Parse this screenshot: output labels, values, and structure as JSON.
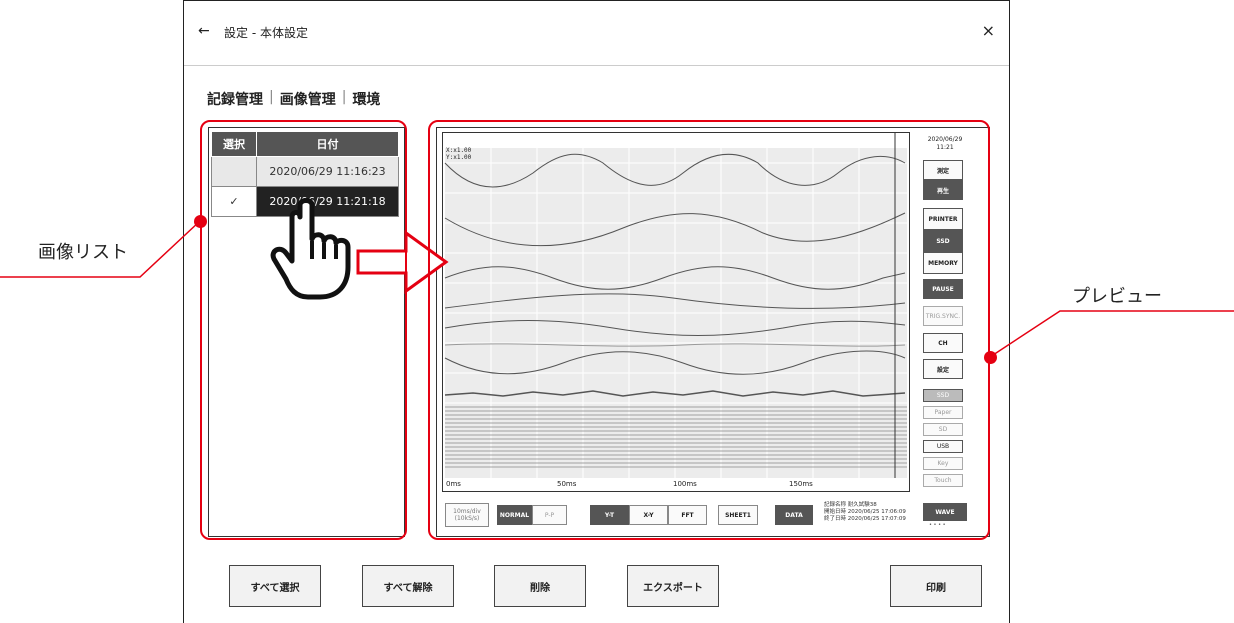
{
  "dialog": {
    "title": "設定 - 本体設定",
    "back_icon": "←",
    "close_icon": "×"
  },
  "tabs": [
    {
      "label": "記録管理"
    },
    {
      "label": "画像管理"
    },
    {
      "label": "環境"
    }
  ],
  "tab_separator": "|",
  "image_list": {
    "headers": {
      "select": "選択",
      "date": "日付"
    },
    "rows": [
      {
        "checked": "",
        "date": "2020/06/29 11:16:23"
      },
      {
        "checked": "✓",
        "date": "2020/06/29 11:21:18"
      }
    ]
  },
  "callouts": {
    "left": "画像リスト",
    "right": "プレビュー"
  },
  "preview": {
    "scale_x": "X:x1.00",
    "scale_y": "Y:x1.00",
    "date": "2020/06/29",
    "time": "11:21",
    "time_labels": [
      "0ms",
      "50ms",
      "100ms",
      "150ms"
    ],
    "side_buttons": [
      "測定",
      "再生",
      "PRINTER",
      "SSD",
      "MEMORY",
      "PAUSE",
      "TRIG.SYNC.",
      "CH",
      "設定"
    ],
    "status_items": [
      "SSD",
      "Paper",
      "SD",
      "USB",
      "Key",
      "Touch"
    ],
    "bottom": {
      "timebase": "10ms/div",
      "rate": "(10kS/s)",
      "normal": "NORMAL",
      "pp": "P-P",
      "yt": "Y-T",
      "xy": "X-Y",
      "fft": "FFT",
      "sheet": "SHEET1",
      "data": "DATA",
      "info_line1": "記録名称 耐久試験38",
      "info_line2": "開始日時 2020/06/25 17:06:09",
      "info_line3": "終了日時 2020/06/25 17:07:09",
      "wave": "WAVE",
      "dots": "• • • •"
    }
  },
  "actions": {
    "select_all": "すべて選択",
    "deselect_all": "すべて解除",
    "delete": "削除",
    "export": "エクスポート",
    "print": "印刷"
  }
}
